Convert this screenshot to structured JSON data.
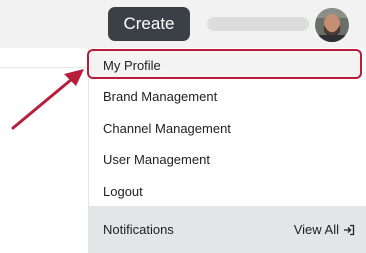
{
  "header": {
    "create_label": "Create"
  },
  "menu": {
    "items": [
      {
        "label": "My Profile"
      },
      {
        "label": "Brand Management"
      },
      {
        "label": "Channel Management"
      },
      {
        "label": "User Management"
      },
      {
        "label": "Logout"
      }
    ],
    "footer": {
      "title": "Notifications",
      "view_all_label": "View All",
      "view_all_icon": "exit-arrow-icon"
    }
  },
  "colors": {
    "accent_red": "#b81d3c",
    "create_button_bg": "#3b4047",
    "footer_bg": "#e4e5e8"
  }
}
